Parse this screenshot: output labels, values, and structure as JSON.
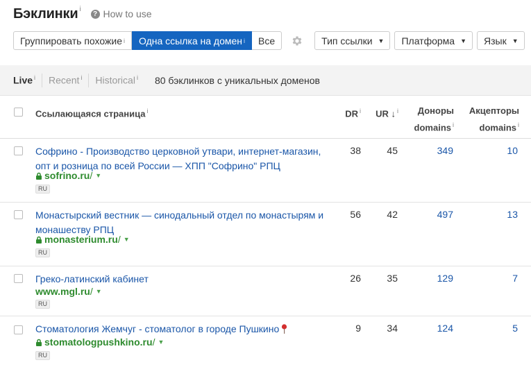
{
  "header": {
    "title": "Бэклинки",
    "title_info": "i",
    "howto": "How to use",
    "howto_icon": "?"
  },
  "toolbar": {
    "group_similar": "Группировать похожие",
    "one_per_domain": "Одна ссылка на домен",
    "all": "Все",
    "info": "i",
    "link_type": "Тип ссылки",
    "platform": "Платформа",
    "language": "Язык"
  },
  "filters": {
    "live": "Live",
    "recent": "Recent",
    "historical": "Historical",
    "info": "i",
    "count_text": "80 бэклинков с уникальных доменов"
  },
  "columns": {
    "referring_page": "Ссылающаяся страница",
    "dr": "DR",
    "ur": "UR",
    "ur_sort": "↓",
    "donors_line1": "Доноры",
    "donors_line2": "domains",
    "acceptors_line1": "Акцепторы",
    "acceptors_line2": "domains",
    "info": "i"
  },
  "rows": [
    {
      "title": "Софрино - Производство церковной утвари, интернет-магазин, опт и розница по всей России — ХПП \"Софрино\" РПЦ",
      "domain": "sofrino.ru",
      "path": "/",
      "lang": "RU",
      "dr": "38",
      "ur": "45",
      "donors": "349",
      "acceptors": "10"
    },
    {
      "title": "Монастырский вестник — синодальный отдел по монастырям и монашеству РПЦ",
      "domain": "monasterium.ru",
      "path": "/",
      "lang": "RU",
      "dr": "56",
      "ur": "42",
      "donors": "497",
      "acceptors": "13"
    },
    {
      "title": "Греко-латинский кабинет",
      "domain": "www.mgl.ru",
      "path": "/",
      "lang": "RU",
      "dr": "26",
      "ur": "35",
      "donors": "129",
      "acceptors": "7"
    },
    {
      "title": "Стоматология Жемчуг - стоматолог в городе Пушкино",
      "domain": "stomatologpushkino.ru",
      "path": "/",
      "lang": "RU",
      "dr": "9",
      "ur": "34",
      "donors": "124",
      "acceptors": "5"
    }
  ],
  "colors": {
    "accent": "#1565c0",
    "link": "#1a56a8",
    "url_green": "#2e8b2e",
    "pin_red": "#d32f2f"
  }
}
